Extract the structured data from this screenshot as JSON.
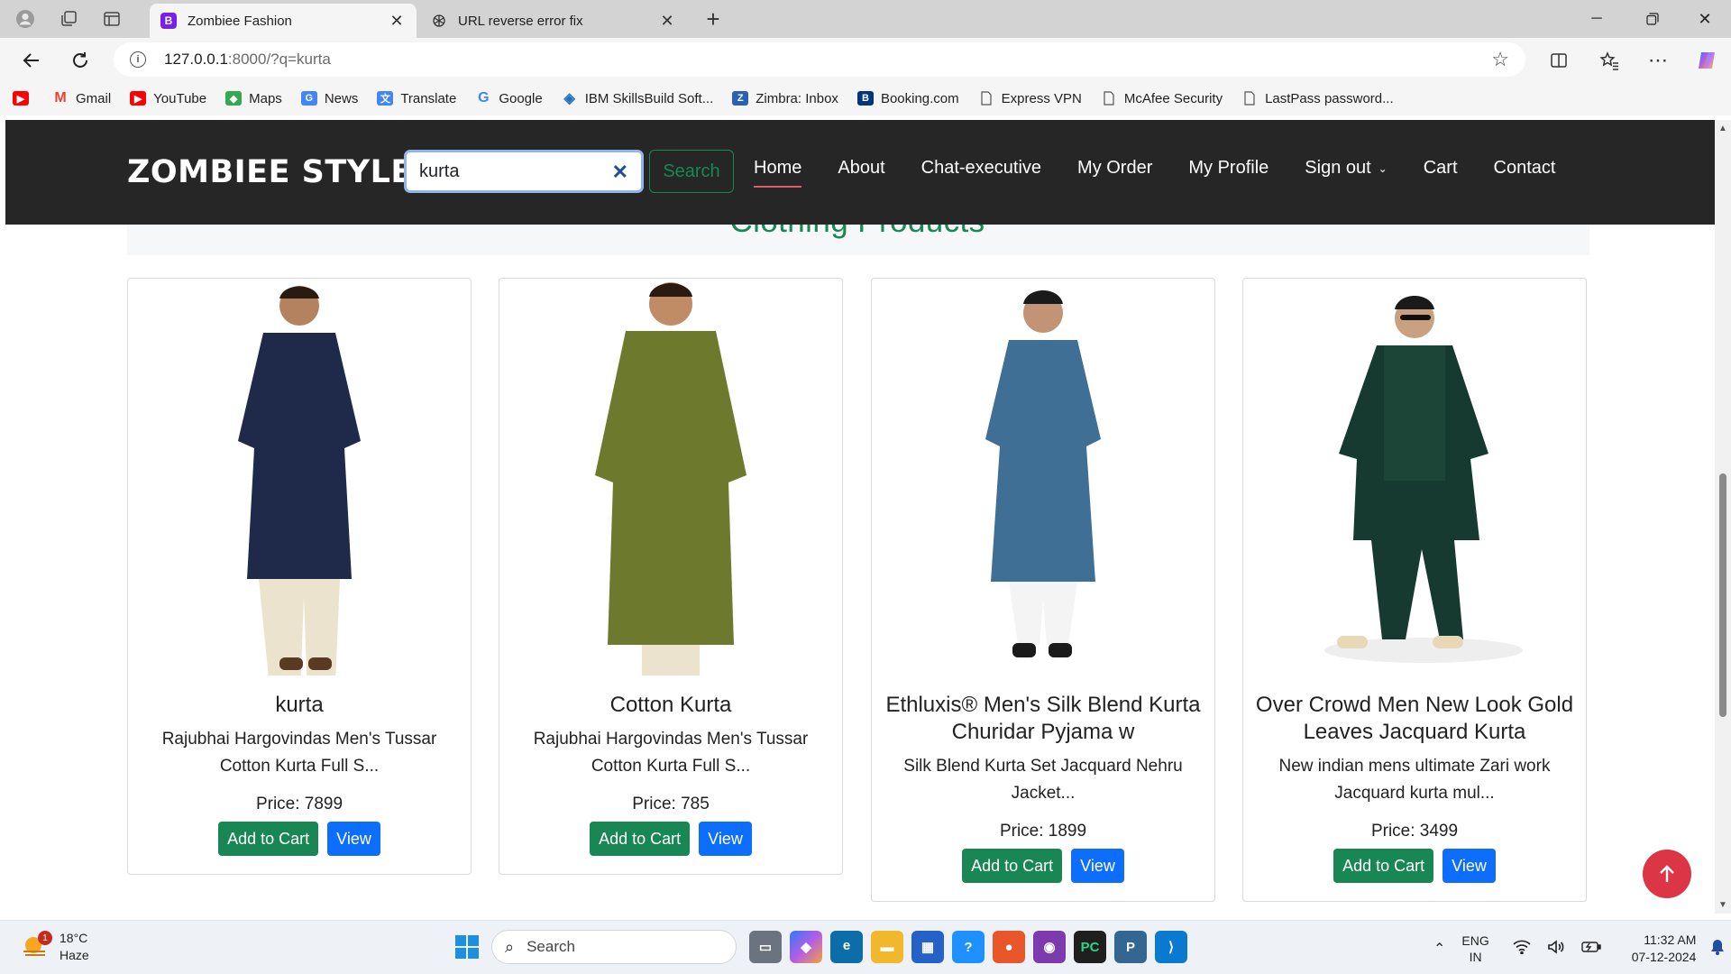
{
  "browser": {
    "tabs": [
      {
        "title": "Zombiee Fashion",
        "favicon": "B",
        "favicon_color": "#7a1fe6",
        "active": true
      },
      {
        "title": "URL reverse error fix",
        "favicon": "openai-icon",
        "active": false
      }
    ],
    "url": {
      "host": "127.0.0.1",
      "rest": ":8000/?q=kurta"
    },
    "bookmarks": [
      {
        "label": "",
        "icon": "youtube-icon",
        "color": "#ff0000"
      },
      {
        "label": "Gmail",
        "icon": "gmail-icon",
        "color": "#ea4335"
      },
      {
        "label": "YouTube",
        "icon": "youtube-icon",
        "color": "#ff0000"
      },
      {
        "label": "Maps",
        "icon": "maps-icon",
        "color": "#34a853"
      },
      {
        "label": "News",
        "icon": "news-icon",
        "color": "#4285f4"
      },
      {
        "label": "Translate",
        "icon": "translate-icon",
        "color": "#4285f4"
      },
      {
        "label": "Google",
        "icon": "google-icon",
        "color": "#4285f4"
      },
      {
        "label": "IBM SkillsBuild Soft...",
        "icon": "ibm-icon",
        "color": "#1f70c1"
      },
      {
        "label": "Zimbra: Inbox",
        "icon": "zimbra-icon",
        "color": "#2a62b3"
      },
      {
        "label": "Booking.com",
        "icon": "booking-icon",
        "color": "#003580"
      },
      {
        "label": "Express VPN",
        "icon": "page-icon",
        "color": "#666666"
      },
      {
        "label": "McAfee Security",
        "icon": "page-icon",
        "color": "#666666"
      },
      {
        "label": "LastPass password...",
        "icon": "page-icon",
        "color": "#666666"
      }
    ]
  },
  "site": {
    "brand": "ZOMBIEE STYLE",
    "search_value": "kurta",
    "search_button": "Search",
    "nav": [
      "Home",
      "About",
      "Chat-executive",
      "My Order",
      "My Profile",
      "Sign out",
      "Cart",
      "Contact"
    ],
    "active_nav": "Home",
    "section_title": "Clothing Products",
    "products": [
      {
        "title": "kurta",
        "desc": "Rajubhai Hargovindas Men's Tussar Cotton Kurta Full S...",
        "price": "Price: 7899",
        "kurta_color": "#1f2a4a",
        "pant_color": "#ece3cf"
      },
      {
        "title": "Cotton Kurta",
        "desc": "Rajubhai Hargovindas Men's Tussar Cotton Kurta Full S...",
        "price": "Price: 785",
        "kurta_color": "#6d7a2e",
        "pant_color": "#ece3cf"
      },
      {
        "title": "Ethluxis® Men's Silk Blend Kurta Churidar Pyjama w",
        "desc": "Silk Blend Kurta Set Jacquard Nehru Jacket...",
        "price": "Price: 1899",
        "kurta_color": "#3f6f94",
        "pant_color": "#f4f4f4"
      },
      {
        "title": "Over Crowd Men New Look Gold Leaves Jacquard Kurta",
        "desc": "New indian mens ultimate Zari work Jacquard kurta mul...",
        "price": "Price: 3499",
        "kurta_color": "#163a30",
        "pant_color": "#163a30"
      }
    ],
    "add_to_cart": "Add to Cart",
    "view": "View"
  },
  "taskbar": {
    "weather_temp": "18°C",
    "weather_desc": "Haze",
    "weather_badge": "1",
    "search_placeholder": "Search",
    "lang_top": "ENG",
    "lang_bottom": "IN",
    "time": "11:32 AM",
    "date": "07-12-2024"
  }
}
